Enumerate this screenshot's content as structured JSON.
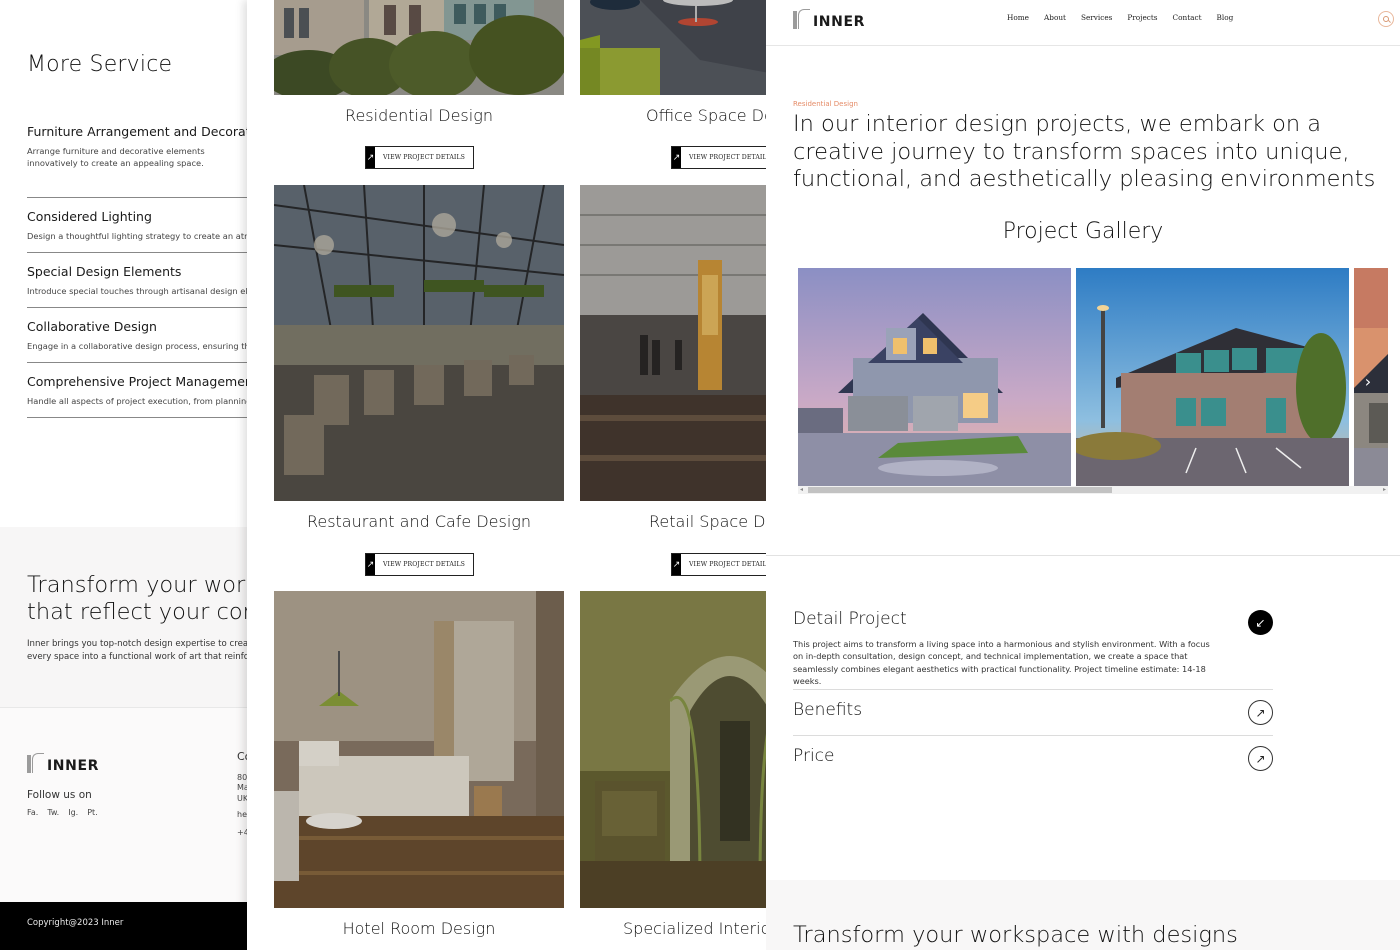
{
  "left_panel": {
    "section_title": "More Service",
    "services": [
      {
        "title": "Furniture Arrangement and Decoration",
        "description": "Arrange furniture and decorative elements innovatively to create an appealing space."
      },
      {
        "title": "Considered Lighting",
        "description": "Design a thoughtful lighting strategy to create an atmosphere"
      },
      {
        "title": "Special Design Elements",
        "description": "Introduce special touches through artisanal design elements"
      },
      {
        "title": "Collaborative Design",
        "description": "Engage in a collaborative design process, ensuring that your"
      },
      {
        "title": "Comprehensive Project Management",
        "description": "Handle all aspects of project execution, from planning to"
      }
    ],
    "cta": {
      "title_line1": "Transform your workspace with designs",
      "title_line2": "that reflect your company",
      "text_line1": "Inner brings you top-notch design expertise to create",
      "text_line2": "every space into a functional work of art that reinforces"
    },
    "footer": {
      "logo_text": "INNER",
      "follow_label": "Follow us on",
      "socials": [
        "Fa.",
        "Tw.",
        "Ig.",
        "Pt."
      ],
      "contact_title": "Co",
      "contact_lines": [
        "80",
        "Ma",
        "UK",
        "he",
        "+4"
      ],
      "copyright": "Copyright@2023 Inner"
    }
  },
  "middle_panel": {
    "button_label": "VIEW PROJECT DETAILS",
    "button_icon": "arrow-up-right-icon",
    "projects": [
      {
        "title": "Residential Design"
      },
      {
        "title": "Office  Space Design"
      },
      {
        "title": "Restaurant and Cafe Design"
      },
      {
        "title": "Retail Space Design"
      },
      {
        "title": "Hotel Room Design"
      },
      {
        "title": "Specialized Interior Design"
      }
    ]
  },
  "right_panel": {
    "logo_text": "INNER",
    "nav": [
      "Home",
      "About",
      "Services",
      "Projects",
      "Contact",
      "Blog"
    ],
    "search_icon": "search-icon",
    "accent_color": "#e58c68",
    "eyebrow": "Residential Design",
    "headline": "In our interior design projects, we embark on a creative journey to transform spaces into unique, functional, and aesthetically pleasing environments",
    "gallery_title": "Project Gallery",
    "gallery_images": [
      "suburban-house-at-dusk",
      "modern-office-building",
      "house-partial"
    ],
    "gallery_next_icon": "chevron-right-icon",
    "accordion": [
      {
        "title": "Detail Project",
        "expanded": true,
        "body": "This project aims to transform a living space into a harmonious and stylish environment. With a focus on in-depth consultation, design concept, and technical implementation, we create a space that seamlessly combines elegant aesthetics with practical functionality. Project timeline estimate: 14-18 weeks."
      },
      {
        "title": "Benefits",
        "expanded": false
      },
      {
        "title": "Price",
        "expanded": false
      }
    ],
    "bottom_title": "Transform your workspace with designs"
  }
}
